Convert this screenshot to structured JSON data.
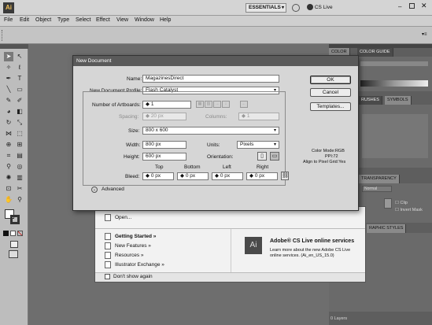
{
  "app": {
    "logo": "Ai",
    "workspace": "ESSENTIALS",
    "cs_live": "CS Live"
  },
  "menu": [
    "File",
    "Edit",
    "Object",
    "Type",
    "Select",
    "Effect",
    "View",
    "Window",
    "Help"
  ],
  "panels": {
    "color_tab": "COLOR",
    "color_guide_tab": "COLOR GUIDE",
    "brushes_tab": "RUSHES",
    "symbols_tab": "SYMBOLS",
    "transparency_tab": "TRANSPARENCY",
    "normal": "Normal",
    "clip": "Clip",
    "invert_mask": "Invert Mask",
    "graphic_styles_tab": "RAPHIC STYLES",
    "layers_count": "0 Layers"
  },
  "welcome": {
    "open": "Open...",
    "getting_started": "Getting Started »",
    "new_features": "New Features »",
    "resources": "Resources »",
    "illustrator_exchange": "Illustrator Exchange »",
    "cs_live_title": "Adobe® CS Live online services",
    "cs_live_desc_1": "Learn more about the new Adobe CS Live",
    "cs_live_desc_2": "online services. (Ai_en_US_15.0)",
    "dont_show": "Don't show again"
  },
  "dialog": {
    "title": "New Document",
    "name_label": "Name:",
    "name_value": "MagazinesDirect",
    "profile_label": "New Document Profile:",
    "profile_value": "Flash Catalyst",
    "artboards_label": "Number of Artboards:",
    "artboards_value": "1",
    "spacing_label": "Spacing:",
    "spacing_value": "20 px",
    "columns_label": "Columns:",
    "columns_value": "1",
    "size_label": "Size:",
    "size_value": "800 x 600",
    "width_label": "Width:",
    "width_value": "800 px",
    "units_label": "Units:",
    "units_value": "Pixels",
    "height_label": "Height:",
    "height_value": "600 px",
    "orientation_label": "Orientation:",
    "bleed_label": "Bleed:",
    "bleed_top_label": "Top",
    "bleed_bottom_label": "Bottom",
    "bleed_left_label": "Left",
    "bleed_right_label": "Right",
    "bleed_top": "0 px",
    "bleed_bottom": "0 px",
    "bleed_left": "0 px",
    "bleed_right": "0 px",
    "advanced_label": "Advanced",
    "ok": "OK",
    "cancel": "Cancel",
    "templates": "Templates...",
    "color_mode": "Color Mode:RGB",
    "ppi": "PPI:72",
    "align_pixel_grid": "Align to Pixel Grid:Yes"
  }
}
